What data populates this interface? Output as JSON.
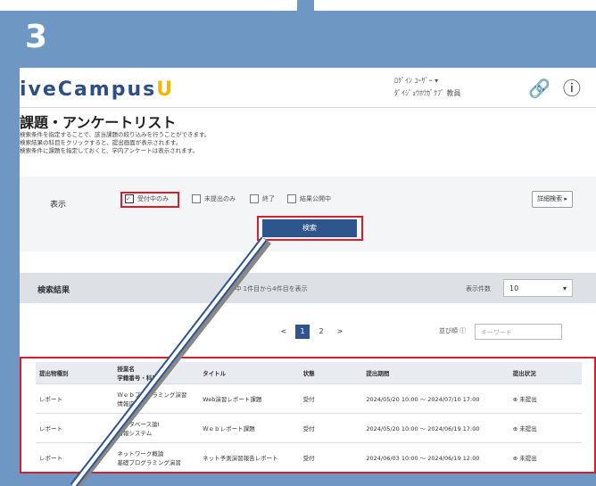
{
  "step_number": "3",
  "brand": {
    "name": "iveCampus",
    "mark": "U"
  },
  "user": {
    "name": "ﾛｸﾞｲﾝ ﾕｰｻﾞｰ ▾",
    "affiliation": "ﾀﾞｲｼﾞｮｳﾎｳｶﾞｸﾌﾞ 教員"
  },
  "header_icons": [
    {
      "name": "link-icon",
      "glyph": "🔗"
    },
    {
      "name": "info-icon",
      "glyph": "ⓘ"
    }
  ],
  "page_title": "課題・アンケートリスト",
  "description": [
    "検索条件を指定することで、該当課題の絞り込みを行うことができます。",
    "検索結果の科目をクリックすると、提出画面が表示されます。",
    "検索条件に課題を指定しておくと、学内アンケートは表示されます。"
  ],
  "filter": {
    "label": "表示",
    "options": [
      {
        "label": "受付中のみ",
        "checked": true
      },
      {
        "label": "未提出のみ",
        "checked": false
      },
      {
        "label": "終了",
        "checked": false
      },
      {
        "label": "結果公開中",
        "checked": false
      }
    ],
    "reset_label": "詳細検索 ▸",
    "search_label": "検索"
  },
  "results": {
    "title": "検索結果",
    "count_text": "4件中 1件目から4件目を表示",
    "per_page_label": "表示件数",
    "per_page_value": "10"
  },
  "pagination": {
    "prev": "<",
    "current": "1",
    "next_page": "2",
    "next": ">"
  },
  "sort": {
    "label": "並び順 ⓘ",
    "placeholder": "キーワード"
  },
  "table": {
    "headers": [
      "提出物種別",
      "授業名\n学籍番号・科目",
      "タイトル",
      "状態",
      "提出期間",
      "提出状況"
    ],
    "rows": [
      [
        "レポート",
        "Ｗｅｂプログラミング演習\n情報応用",
        "Web演習レポート課題",
        "受付",
        "2024/05/20 10:00 ～ 2024/07/10 17:00",
        "⊕ 未提出"
      ],
      [
        "レポート",
        "データベース論Ⅰ\n情報システム",
        "Ｗｅｂレポート課題",
        "受付",
        "2024/05/20 10:00 ～ 2024/06/19 17:00",
        "⊕ 未提出"
      ],
      [
        "レポート",
        "ネットワーク概論\n基礎プログラミング演習",
        "ネット予測演習報告レポート",
        "受付",
        "2024/06/03 10:00 ～ 2024/06/19 12:00",
        "⊕ 未提出"
      ]
    ]
  }
}
